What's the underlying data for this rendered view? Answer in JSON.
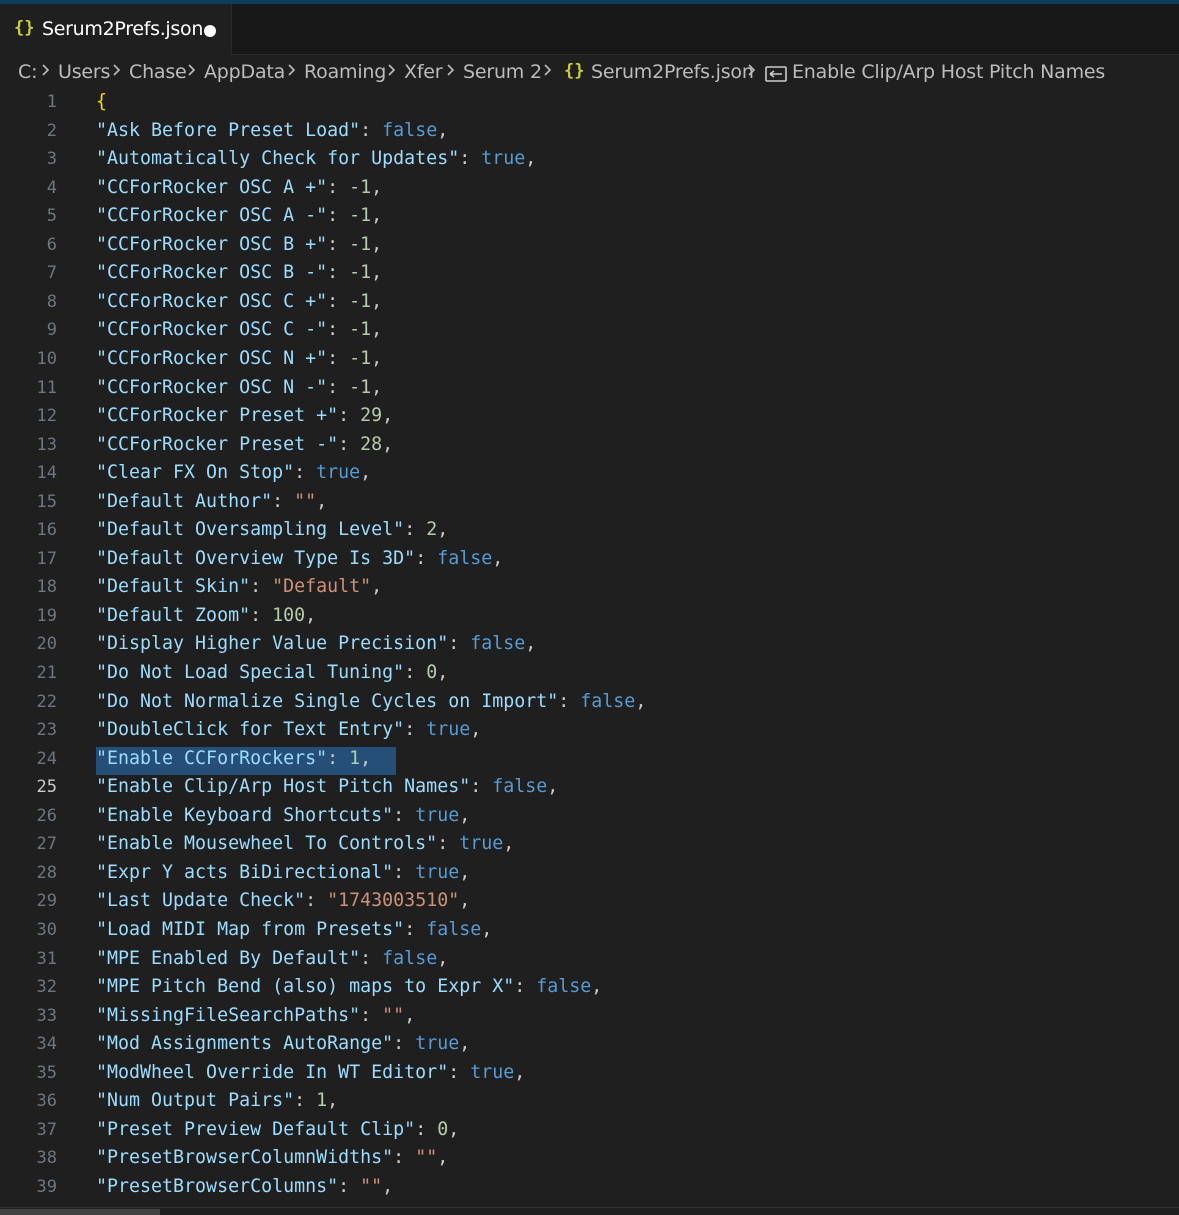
{
  "tab": {
    "icon": "{}",
    "label": "Serum2Prefs.json",
    "dirty": true
  },
  "breadcrumb": {
    "items": [
      "C:",
      "Users",
      "Chase",
      "AppData",
      "Roaming",
      "Xfer",
      "Serum 2",
      "Serum2Prefs.json",
      "Enable Clip/Arp Host Pitch Names"
    ],
    "file_icon": "{}",
    "symbol_icon": "property-icon"
  },
  "editor": {
    "active_line": 25,
    "selected_line": 24,
    "lines": [
      {
        "num": "1",
        "kind": "open",
        "text": "{"
      },
      {
        "num": "2",
        "key": "\"Ask Before Preset Load\"",
        "type": "b",
        "value": "false"
      },
      {
        "num": "3",
        "key": "\"Automatically Check for Updates\"",
        "type": "b",
        "value": "true"
      },
      {
        "num": "4",
        "key": "\"CCForRocker OSC A +\"",
        "type": "n",
        "value": "-1"
      },
      {
        "num": "5",
        "key": "\"CCForRocker OSC A -\"",
        "type": "n",
        "value": "-1"
      },
      {
        "num": "6",
        "key": "\"CCForRocker OSC B +\"",
        "type": "n",
        "value": "-1"
      },
      {
        "num": "7",
        "key": "\"CCForRocker OSC B -\"",
        "type": "n",
        "value": "-1"
      },
      {
        "num": "8",
        "key": "\"CCForRocker OSC C +\"",
        "type": "n",
        "value": "-1"
      },
      {
        "num": "9",
        "key": "\"CCForRocker OSC C -\"",
        "type": "n",
        "value": "-1"
      },
      {
        "num": "10",
        "key": "\"CCForRocker OSC N +\"",
        "type": "n",
        "value": "-1"
      },
      {
        "num": "11",
        "key": "\"CCForRocker OSC N -\"",
        "type": "n",
        "value": "-1"
      },
      {
        "num": "12",
        "key": "\"CCForRocker Preset +\"",
        "type": "n",
        "value": "29"
      },
      {
        "num": "13",
        "key": "\"CCForRocker Preset -\"",
        "type": "n",
        "value": "28"
      },
      {
        "num": "14",
        "key": "\"Clear FX On Stop\"",
        "type": "b",
        "value": "true"
      },
      {
        "num": "15",
        "key": "\"Default Author\"",
        "type": "s",
        "value": "\"\""
      },
      {
        "num": "16",
        "key": "\"Default Oversampling Level\"",
        "type": "n",
        "value": "2"
      },
      {
        "num": "17",
        "key": "\"Default Overview Type Is 3D\"",
        "type": "b",
        "value": "false"
      },
      {
        "num": "18",
        "key": "\"Default Skin\"",
        "type": "s",
        "value": "\"Default\""
      },
      {
        "num": "19",
        "key": "\"Default Zoom\"",
        "type": "n",
        "value": "100"
      },
      {
        "num": "20",
        "key": "\"Display Higher Value Precision\"",
        "type": "b",
        "value": "false"
      },
      {
        "num": "21",
        "key": "\"Do Not Load Special Tuning\"",
        "type": "n",
        "value": "0"
      },
      {
        "num": "22",
        "key": "\"Do Not Normalize Single Cycles on Import\"",
        "type": "b",
        "value": "false"
      },
      {
        "num": "23",
        "key": "\"DoubleClick for Text Entry\"",
        "type": "b",
        "value": "true"
      },
      {
        "num": "24",
        "key": "\"Enable CCForRockers\"",
        "type": "n",
        "value": "1"
      },
      {
        "num": "25",
        "key": "\"Enable Clip/Arp Host Pitch Names\"",
        "type": "b",
        "value": "false"
      },
      {
        "num": "26",
        "key": "\"Enable Keyboard Shortcuts\"",
        "type": "b",
        "value": "true"
      },
      {
        "num": "27",
        "key": "\"Enable Mousewheel To Controls\"",
        "type": "b",
        "value": "true"
      },
      {
        "num": "28",
        "key": "\"Expr Y acts BiDirectional\"",
        "type": "b",
        "value": "true"
      },
      {
        "num": "29",
        "key": "\"Last Update Check\"",
        "type": "s",
        "value": "\"1743003510\""
      },
      {
        "num": "30",
        "key": "\"Load MIDI Map from Presets\"",
        "type": "b",
        "value": "false"
      },
      {
        "num": "31",
        "key": "\"MPE Enabled By Default\"",
        "type": "b",
        "value": "false"
      },
      {
        "num": "32",
        "key": "\"MPE Pitch Bend (also) maps to Expr X\"",
        "type": "b",
        "value": "false"
      },
      {
        "num": "33",
        "key": "\"MissingFileSearchPaths\"",
        "type": "s",
        "value": "\"\""
      },
      {
        "num": "34",
        "key": "\"Mod Assignments AutoRange\"",
        "type": "b",
        "value": "true"
      },
      {
        "num": "35",
        "key": "\"ModWheel Override In WT Editor\"",
        "type": "b",
        "value": "true"
      },
      {
        "num": "36",
        "key": "\"Num Output Pairs\"",
        "type": "n",
        "value": "1"
      },
      {
        "num": "37",
        "key": "\"Preset Preview Default Clip\"",
        "type": "n",
        "value": "0"
      },
      {
        "num": "38",
        "key": "\"PresetBrowserColumnWidths\"",
        "type": "s",
        "value": "\"\""
      },
      {
        "num": "39",
        "key": "\"PresetBrowserColumns\"",
        "type": "s",
        "value": "\"\""
      }
    ]
  },
  "colors": {
    "key": "#9cdcfe",
    "boolean": "#569cd6",
    "number": "#b5cea8",
    "string": "#ce9178",
    "selection": "#264f78"
  }
}
